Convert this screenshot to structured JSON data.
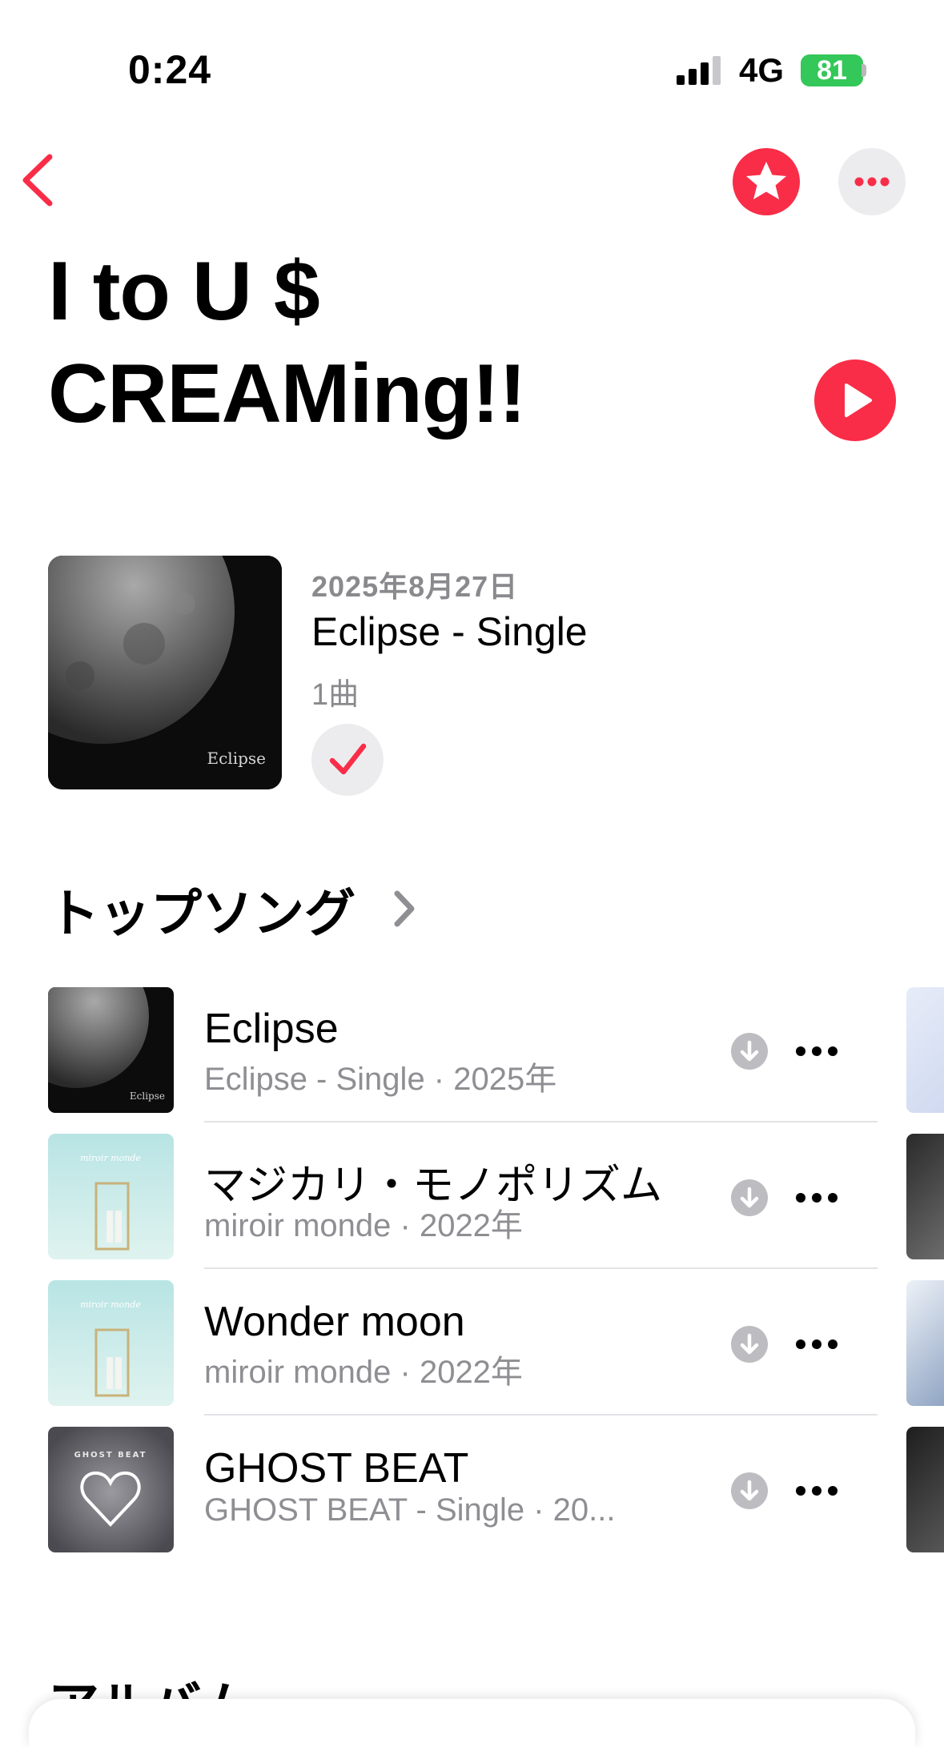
{
  "status": {
    "time": "0:24",
    "network": "4G",
    "battery": "81"
  },
  "artist": {
    "name_line1": "I to U $",
    "name_line2": "CREAMing!!"
  },
  "latest": {
    "date": "2025年8月27日",
    "title": "Eclipse - Single",
    "count": "1曲",
    "art_text": "Eclipse"
  },
  "top_songs": {
    "header": "トップソング",
    "items": [
      {
        "title": "Eclipse",
        "subtitle": "Eclipse - Single · 2025年",
        "art_text": "Eclipse"
      },
      {
        "title": "マジカリ・モノポリズム",
        "subtitle": "miroir monde · 2022年",
        "art_text": "miroir monde"
      },
      {
        "title": "Wonder moon",
        "subtitle": "miroir monde · 2022年",
        "art_text": "miroir monde"
      },
      {
        "title": "GHOST BEAT",
        "subtitle": "GHOST BEAT - Single · 20...",
        "art_text": "GHOST BEAT"
      }
    ]
  },
  "albums_header": "アルバム",
  "colors": {
    "accent": "#fa2d48",
    "battery": "#34c759",
    "secondary_text": "#8e8e93"
  }
}
